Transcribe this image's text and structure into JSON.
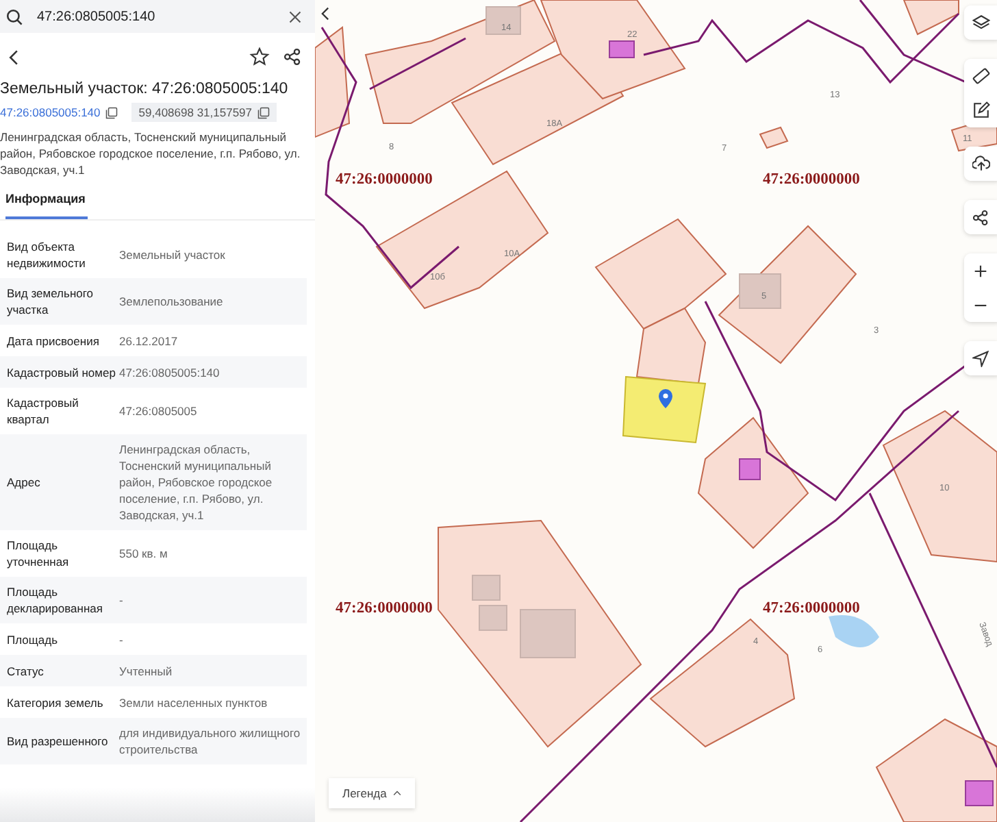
{
  "search": {
    "value": "47:26:0805005:140"
  },
  "header": {
    "title": "Земельный участок: 47:26:0805005:140",
    "cadastral_link": "47:26:0805005:140",
    "coordinates": "59,408698 31,157597",
    "address": "Ленинградская область, Тосненский муниципальный район, Рябовское городское поселение, г.п. Рябово, ул. Заводская, уч.1"
  },
  "tabs": [
    {
      "label": "Информация",
      "selected": true
    }
  ],
  "rows": [
    {
      "label": "Вид объекта недвижимости",
      "value": "Земельный участок"
    },
    {
      "label": "Вид земельного участка",
      "value": "Землепользование"
    },
    {
      "label": "Дата присвоения",
      "value": "26.12.2017"
    },
    {
      "label": "Кадастровый номер",
      "value": "47:26:0805005:140"
    },
    {
      "label": "Кадастровый квартал",
      "value": "47:26:0805005"
    },
    {
      "label": "Адрес",
      "value": "Ленинградская область, Тосненский муниципальный район, Рябовское городское поселение, г.п. Рябово, ул. Заводская, уч.1"
    },
    {
      "label": "Площадь уточненная",
      "value": "550 кв. м"
    },
    {
      "label": "Площадь декларированная",
      "value": "-"
    },
    {
      "label": "Площадь",
      "value": "-"
    },
    {
      "label": "Статус",
      "value": "Учтенный"
    },
    {
      "label": "Категория земель",
      "value": "Земли населенных пунктов"
    },
    {
      "label": "Вид разрешенного",
      "value": "для индивидуального жилищного строительства"
    }
  ],
  "map": {
    "quarter_labels": [
      "47:26:0000000",
      "47:26:0000000",
      "47:26:0000000",
      "47:26:0000000"
    ],
    "house_numbers": [
      "14",
      "22",
      "13",
      "18А",
      "8",
      "7",
      "11",
      "10А",
      "10б",
      "5",
      "3",
      "10",
      "4",
      "6"
    ],
    "street": "Завод",
    "legend_button": "Легенда"
  }
}
